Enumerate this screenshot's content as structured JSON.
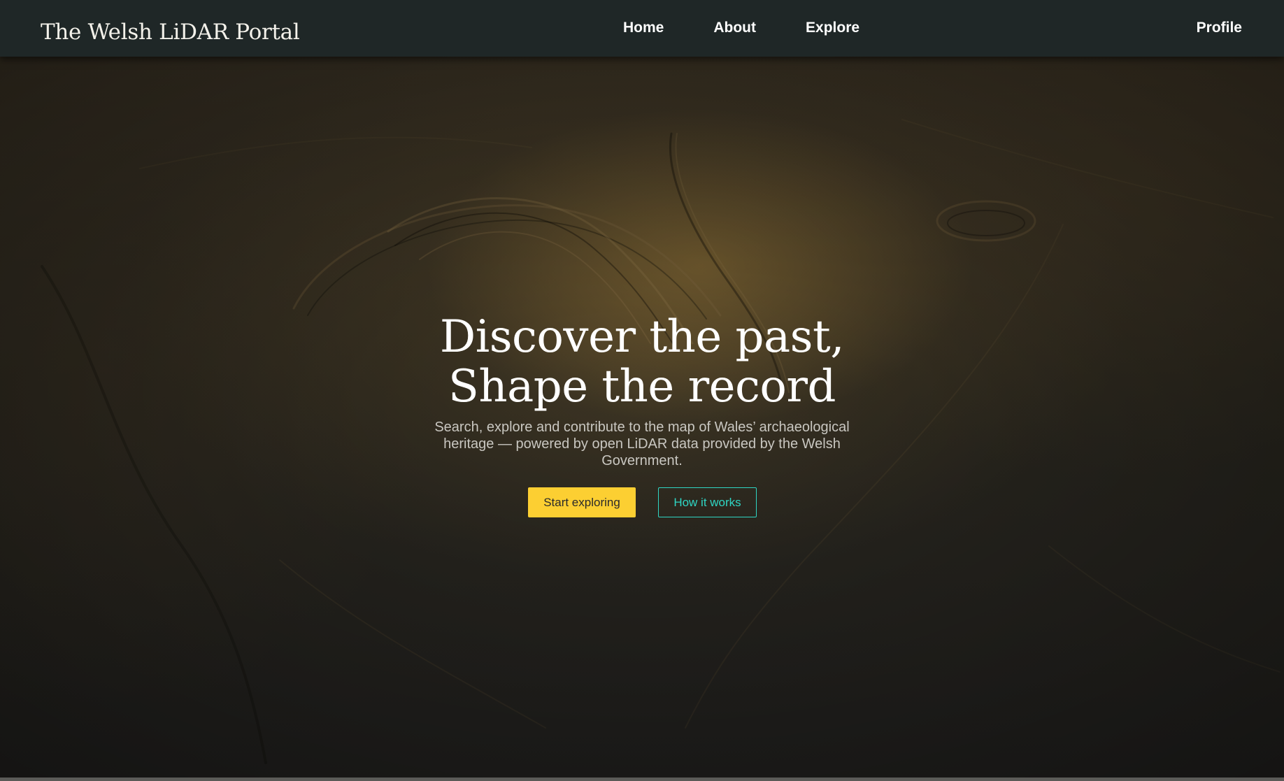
{
  "nav": {
    "brand": "The Welsh LiDAR Portal",
    "links": [
      {
        "label": "Home"
      },
      {
        "label": "About"
      },
      {
        "label": "Explore"
      }
    ],
    "profile": "Profile"
  },
  "hero": {
    "title_line1": "Discover the past,",
    "title_line2": "Shape the record",
    "subtitle": "Search, explore and contribute to the map of Wales’ archaeological heritage — powered by open LiDAR data provided by the Welsh Government.",
    "primary_button": "Start exploring",
    "secondary_button": "How it works"
  },
  "colors": {
    "navbar_bg": "#1f2727",
    "primary_button_bg": "#fccf32",
    "secondary_button_accent": "#2fd6c4",
    "hero_text": "#ffffff",
    "subtitle_text": "#c9c7c1"
  }
}
